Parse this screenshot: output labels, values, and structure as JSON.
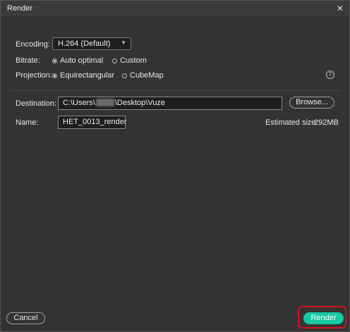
{
  "window": {
    "title": "Render",
    "close_glyph": "✕"
  },
  "encoding": {
    "label": "Encoding:",
    "selected": "H.264 (Default)"
  },
  "bitrate": {
    "label": "Bitrate:",
    "options": [
      {
        "label": "Auto optimal",
        "selected": true
      },
      {
        "label": "Custom",
        "selected": false
      }
    ]
  },
  "projection": {
    "label": "Projection:",
    "options": [
      {
        "label": "Equirectangular",
        "selected": true
      },
      {
        "label": "CubeMap",
        "selected": false
      }
    ],
    "help_glyph": "?"
  },
  "destination": {
    "label": "Destination:",
    "path_prefix": "C:\\Users\\",
    "path_suffix": "\\Desktop\\Vuze",
    "browse_label": "Browse..."
  },
  "name": {
    "label": "Name:",
    "value": "HET_0013_render"
  },
  "estimated_size": {
    "label": "Estimated size:",
    "value": "292MB"
  },
  "footer": {
    "cancel_label": "Cancel",
    "render_label": "Render"
  },
  "colors": {
    "accent": "#17c8a5",
    "highlight": "#d80f1e",
    "background": "#333333"
  },
  "icons": [
    "close-icon",
    "chevron-down-icon",
    "help-icon"
  ]
}
